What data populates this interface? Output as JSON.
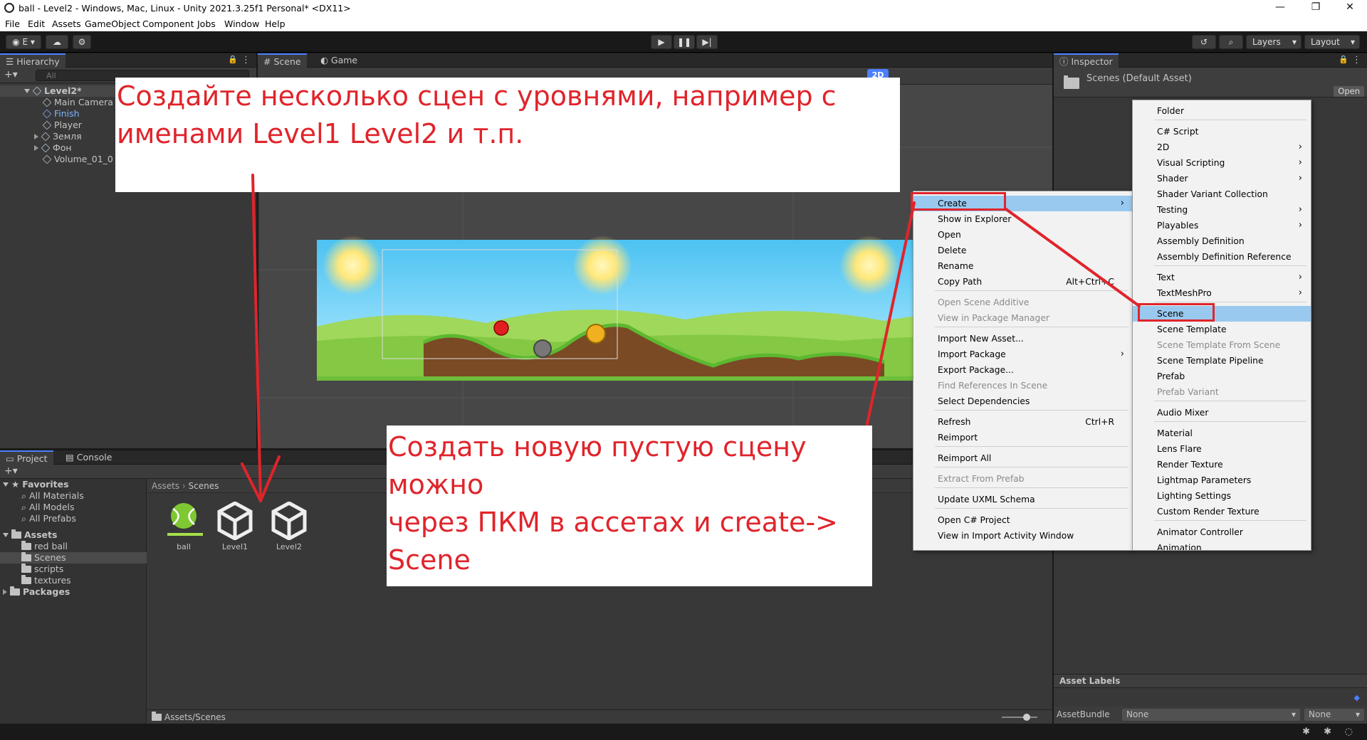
{
  "window": {
    "title": "ball - Level2 - Windows, Mac, Linux - Unity 2021.3.25f1 Personal* <DX11>",
    "minimize": "—",
    "maximize": "❐",
    "close": "✕"
  },
  "menubar": [
    "File",
    "Edit",
    "Assets",
    "GameObject",
    "Component",
    "Jobs",
    "Window",
    "Help"
  ],
  "toolbar": {
    "account": "E",
    "layers": "Layers",
    "layout": "Layout"
  },
  "hierarchy": {
    "tab": "Hierarchy",
    "search_placeholder": "All",
    "scene": "Level2*",
    "items": [
      "Main Camera",
      "Finish",
      "Player",
      "Земля",
      "Фон",
      "Volume_01_0"
    ]
  },
  "scene_view": {
    "tabs": [
      "Scene",
      "Game"
    ],
    "mode_2d": "2D"
  },
  "project": {
    "tabs": [
      "Project",
      "Console"
    ],
    "favorites": {
      "label": "Favorites",
      "items": [
        "All Materials",
        "All Models",
        "All Prefabs"
      ]
    },
    "assets": {
      "label": "Assets",
      "items": [
        "red ball",
        "Scenes",
        "scripts",
        "textures"
      ]
    },
    "packages": "Packages",
    "breadcrumb": [
      "Assets",
      "Scenes"
    ],
    "files": [
      "ball",
      "Level1",
      "Level2"
    ],
    "footer_path": "Assets/Scenes"
  },
  "inspector": {
    "tab": "Inspector",
    "asset": "Scenes (Default Asset)",
    "open": "Open",
    "asset_labels": "Asset Labels",
    "assetbundle_label": "AssetBundle",
    "assetbundle_value": "None",
    "variant_value": "None"
  },
  "context_menu": {
    "items": [
      {
        "label": "Create",
        "arrow": "›",
        "hl": true
      },
      {
        "label": "Show in Explorer"
      },
      {
        "label": "Open"
      },
      {
        "label": "Delete"
      },
      {
        "label": "Rename"
      },
      {
        "label": "Copy Path",
        "shortcut": "Alt+Ctrl+C"
      },
      {
        "label": "Open Scene Additive",
        "dis": true
      },
      {
        "label": "View in Package Manager",
        "dis": true
      },
      {
        "label": "Import New Asset..."
      },
      {
        "label": "Import Package",
        "arrow": "›"
      },
      {
        "label": "Export Package..."
      },
      {
        "label": "Find References In Scene",
        "dis": true
      },
      {
        "label": "Select Dependencies"
      },
      {
        "label": "Refresh",
        "shortcut": "Ctrl+R"
      },
      {
        "label": "Reimport"
      },
      {
        "label": "Reimport All"
      },
      {
        "label": "Extract From Prefab",
        "dis": true
      },
      {
        "label": "Update UXML Schema"
      },
      {
        "label": "Open C# Project"
      },
      {
        "label": "View in Import Activity Window"
      }
    ]
  },
  "create_menu": {
    "items": [
      {
        "label": "Folder"
      },
      {
        "label": "C# Script"
      },
      {
        "label": "2D",
        "arrow": "›"
      },
      {
        "label": "Visual Scripting",
        "arrow": "›"
      },
      {
        "label": "Shader",
        "arrow": "›"
      },
      {
        "label": "Shader Variant Collection"
      },
      {
        "label": "Testing",
        "arrow": "›"
      },
      {
        "label": "Playables",
        "arrow": "›"
      },
      {
        "label": "Assembly Definition"
      },
      {
        "label": "Assembly Definition Reference"
      },
      {
        "label": "Text",
        "arrow": "›"
      },
      {
        "label": "TextMeshPro",
        "arrow": "›"
      },
      {
        "label": "Scene",
        "hl": true
      },
      {
        "label": "Scene Template"
      },
      {
        "label": "Scene Template From Scene",
        "dis": true
      },
      {
        "label": "Scene Template Pipeline"
      },
      {
        "label": "Prefab"
      },
      {
        "label": "Prefab Variant",
        "dis": true
      },
      {
        "label": "Audio Mixer"
      },
      {
        "label": "Material"
      },
      {
        "label": "Lens Flare"
      },
      {
        "label": "Render Texture"
      },
      {
        "label": "Lightmap Parameters"
      },
      {
        "label": "Lighting Settings"
      },
      {
        "label": "Custom Render Texture"
      },
      {
        "label": "Animator Controller"
      },
      {
        "label": "Animation"
      }
    ]
  },
  "annotations": {
    "top_line1": "Создайте несколько сцен с уровнями, например с",
    "top_line2": "именами Level1 Level2 и т.п.",
    "bottom_line1": "Создать новую пустую сцену можно",
    "bottom_line2": "через ПКМ в ассетах и create->",
    "bottom_line3": "Scene"
  },
  "colors": {
    "accent": "#4c7fff",
    "annotation": "#e0242b",
    "menu_highlight": "#99c9ef",
    "selection": "#2c5d87"
  }
}
